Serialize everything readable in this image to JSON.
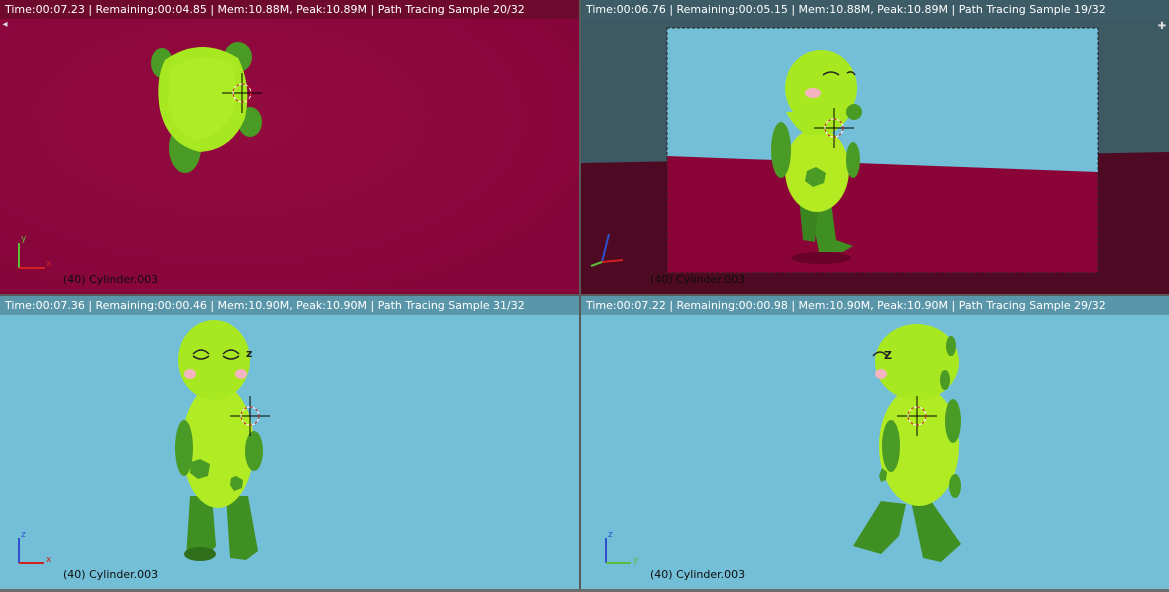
{
  "viewports": {
    "top_left": {
      "stats": "Time:00:07.23 | Remaining:00:04.85 | Mem:10.88M, Peak:10.89M | Path Tracing Sample 20/32",
      "object_label": "(40) Cylinder.003",
      "axis_h": "x",
      "axis_v": "y",
      "view": "top"
    },
    "top_right": {
      "stats": "Time:00:06.76 | Remaining:00:05.15 | Mem:10.88M, Peak:10.89M | Path Tracing Sample 19/32",
      "object_label": "(40) Cylinder.003",
      "view": "camera"
    },
    "bottom_left": {
      "stats": "Time:00:07.36 | Remaining:00:00.46 | Mem:10.90M, Peak:10.90M | Path Tracing Sample 31/32",
      "object_label": "(40) Cylinder.003",
      "axis_h": "x",
      "axis_v": "z",
      "view": "front"
    },
    "bottom_right": {
      "stats": "Time:00:07.22 | Remaining:00:00.98 | Mem:10.90M, Peak:10.90M | Path Tracing Sample 29/32",
      "object_label": "(40) Cylinder.003",
      "axis_h": "y",
      "axis_v": "z",
      "view": "right"
    }
  },
  "colors": {
    "floor_magenta": "#8b0437",
    "sky_blue": "#74bfd8",
    "header_magenta": "#6e0a2d",
    "header_blue": "#5a96aa",
    "character_body": "#a6e61d",
    "character_limb": "#4f9e27"
  },
  "icons": [
    "3d-cursor-icon",
    "axis-gizmo-icon",
    "viewport-split-icon"
  ]
}
